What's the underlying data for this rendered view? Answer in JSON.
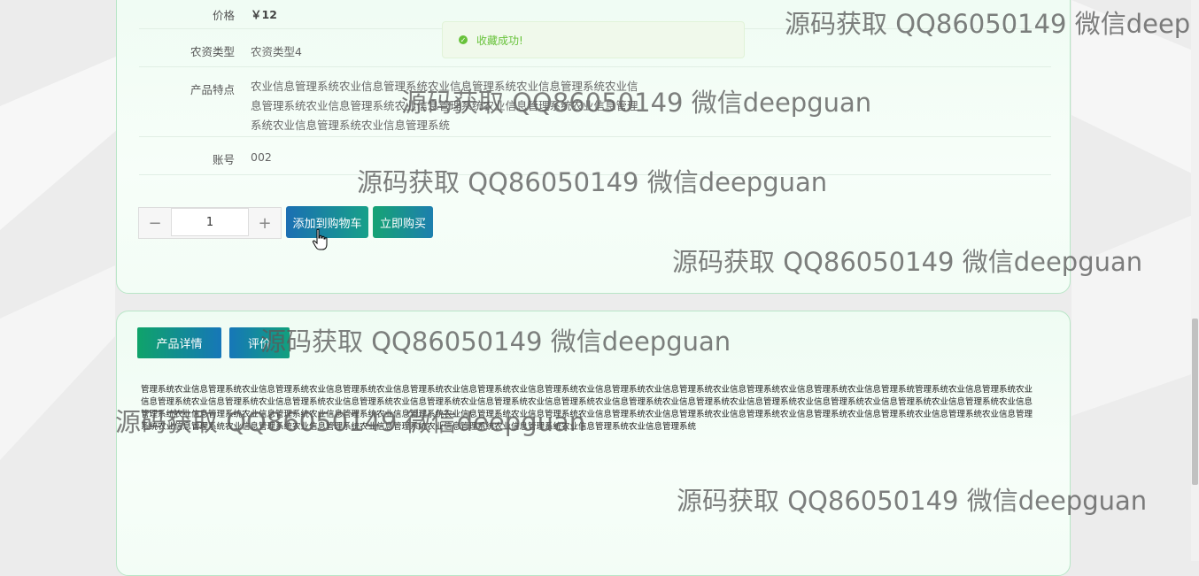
{
  "product": {
    "rows": [
      {
        "label": "价格",
        "value": "￥12"
      },
      {
        "label": "农资类型",
        "value": "农资类型4"
      },
      {
        "label": "产品特点",
        "value": "农业信息管理系统农业信息管理系统农业信息管理系统农业信息管理系统农业信息管理系统农业信息管理系统农业信息管理系统农业信息管理系统农业信息管理系统农业信息管理系统农业信息管理系统"
      },
      {
        "label": "账号",
        "value": "002"
      }
    ],
    "quantity": {
      "minus": "−",
      "value": "1",
      "plus": "+"
    },
    "add_to_cart_label": "添加到购物车",
    "buy_now_label": "立即购买"
  },
  "tabs": {
    "detail_label": "产品详情",
    "review_label": "评价"
  },
  "detail_text": "管理系统农业信息管理系统农业信息管理系统农业信息管理系统农业信息管理系统农业信息管理系统农业信息管理系统农业信息管理系统农业信息管理系统农业信息管理系统农业信息管理系统农业信息管理系统管理系统农业信息管理系统农业信息管理系统农业信息管理系统农业信息管理系统农业信息管理系统农业信息管理系统农业信息管理系统农业信息管理系统农业信息管理系统农业信息管理系统农业信息管理系统农业信息管理系统农业信息管理系统农业信息管理系统农业信息管理系统农业信息管理系统农业信息管理系统农业信息管理系统农业信息管理系统农业信息管理系统农业信息管理系统农业信息管理系统农业信息管理系统农业信息管理系统农业信息管理系统农业信息管理系统农业信息管理系统农业信息管理系统农业信息管理系统农业信息管理系统农业信息管理系统农业信息管理系统农业信息管理系统农业信息管理系统农业信息管理系统农业信息管理系统",
  "toast": {
    "message": "收藏成功!",
    "icon": "check-circle-icon"
  },
  "watermark_text": "源码获取 QQ86050149 微信deepguan",
  "colors": {
    "card_border": "#b9e6c7",
    "toast_green": "#67c23a",
    "primary_blue": "#1b6fb3",
    "primary_green": "#16a374"
  }
}
